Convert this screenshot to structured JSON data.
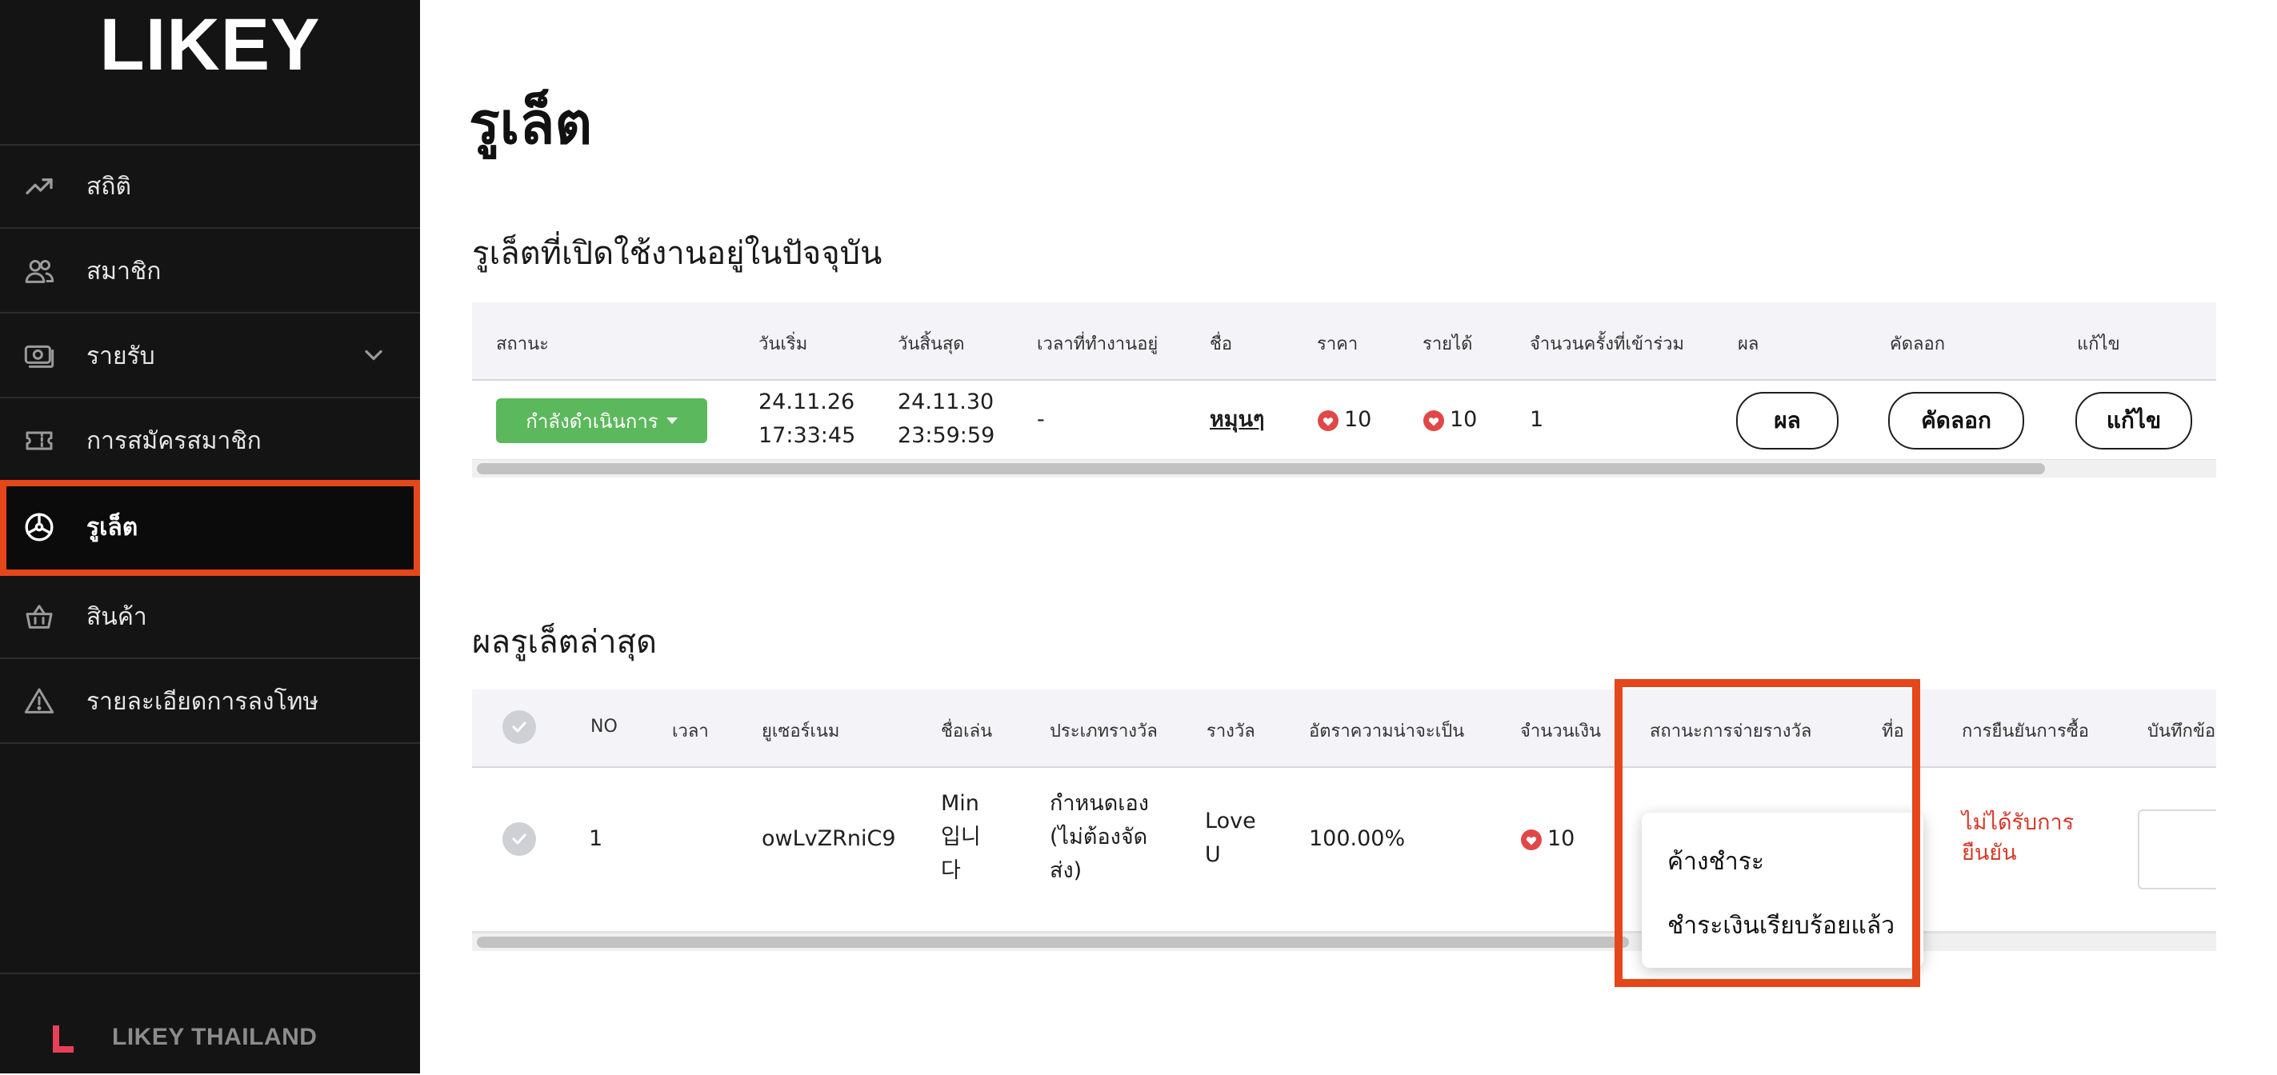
{
  "app": {
    "logo": "LIKEY",
    "footer_brand": "LIKEY THAILAND"
  },
  "colors": {
    "accent_highlight": "#e5461a",
    "status_green": "#5cb85c",
    "heart_red": "#e04848",
    "error_red": "#d63a2a",
    "sidebar_bg": "#141414"
  },
  "sidebar": {
    "items": [
      {
        "label": "สถิติ",
        "icon": "trend-up-icon"
      },
      {
        "label": "สมาชิก",
        "icon": "users-icon"
      },
      {
        "label": "รายรับ",
        "icon": "money-icon",
        "has_chevron": true
      },
      {
        "label": "การสมัครสมาชิก",
        "icon": "ticket-icon"
      },
      {
        "label": "รูเล็ต",
        "icon": "roulette-icon",
        "active": true
      },
      {
        "label": "สินค้า",
        "icon": "basket-icon"
      },
      {
        "label": "รายละเอียดการลงโทษ",
        "icon": "warning-icon"
      }
    ]
  },
  "main": {
    "title": "รูเล็ต",
    "active_section": {
      "title": "รูเล็ตที่เปิดใช้งานอยู่ในปัจจุบัน",
      "columns": [
        "สถานะ",
        "วันเริ่ม",
        "วันสิ้นสุด",
        "เวลาที่ทำงานอยู่",
        "ชื่อ",
        "ราคา",
        "รายได้",
        "จำนวนครั้งที่เข้าร่วม",
        "ผล",
        "คัดลอก",
        "แก้ไข"
      ],
      "row": {
        "status": "กำลังดำเนินการ",
        "start_date": "24.11.26",
        "start_time": "17:33:45",
        "end_date": "24.11.30",
        "end_time": "23:59:59",
        "running_time": "-",
        "name": "หมุนๆ",
        "price": "10",
        "revenue": "10",
        "participations": "1",
        "result_btn": "ผล",
        "copy_btn": "คัดลอก",
        "edit_btn": "แก้ไข"
      }
    },
    "results_section": {
      "title": "ผลรูเล็ตล่าสุด",
      "columns": [
        "NO",
        "เวลา",
        "ยูเซอร์เนม",
        "ชื่อเล่น",
        "ประเภทรางวัล",
        "รางวัล",
        "อัตราความน่าจะเป็น",
        "จำนวนเงิน",
        "สถานะการจ่ายรางวัล",
        "ที่อยู่",
        "การยืนยันการซื้อ",
        "บันทึกข้อความ"
      ],
      "row": {
        "no": "1",
        "time": "",
        "username": "owLvZRniC9",
        "nickname_lines": [
          "Min",
          "입니",
          "다"
        ],
        "prize_type_lines": [
          "กำหนดเอง",
          "(ไม่ต้องจัด",
          "ส่ง)"
        ],
        "prize_lines": [
          "Love",
          "U"
        ],
        "probability": "100.00%",
        "amount": "10",
        "confirmation_lines": [
          "ไม่ได้รับการ",
          "ยืนยัน"
        ]
      },
      "payout_status_dropdown": {
        "options": [
          "ค้างชำระ",
          "ชำระเงินเรียบร้อยแล้ว"
        ]
      }
    }
  }
}
